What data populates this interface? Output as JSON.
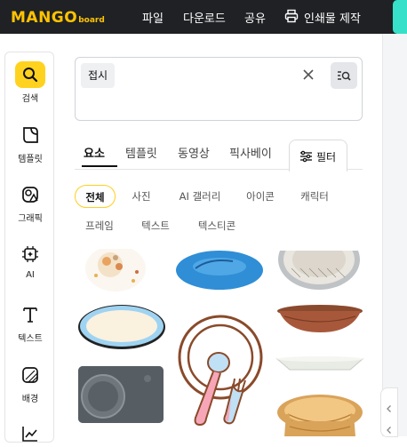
{
  "app": {
    "logo_main": "MANGO",
    "logo_sub": "board",
    "menu": [
      "파일",
      "다운로드",
      "공유",
      "인쇄물 제작"
    ]
  },
  "sidebar": {
    "items": [
      {
        "label": "검색",
        "icon": "search-icon",
        "active": true
      },
      {
        "label": "템플릿",
        "icon": "template-icon"
      },
      {
        "label": "그래픽",
        "icon": "graphic-icon"
      },
      {
        "label": "AI",
        "icon": "ai-chip-icon"
      },
      {
        "label": "텍스트",
        "icon": "text-icon"
      },
      {
        "label": "배경",
        "icon": "background-icon"
      }
    ]
  },
  "search": {
    "query": "접시"
  },
  "tabs": [
    "요소",
    "템플릿",
    "동영상",
    "픽사베이"
  ],
  "filter_label": "필터",
  "categories": [
    "전체",
    "사진",
    "AI 갤러리",
    "아이콘",
    "캐릭터",
    "프레임",
    "텍스트",
    "텍스티콘"
  ],
  "colors": {
    "accent": "#ffd21f",
    "topbar": "#1f2124",
    "logo": "#ffc300",
    "mint": "#37e0c8"
  }
}
